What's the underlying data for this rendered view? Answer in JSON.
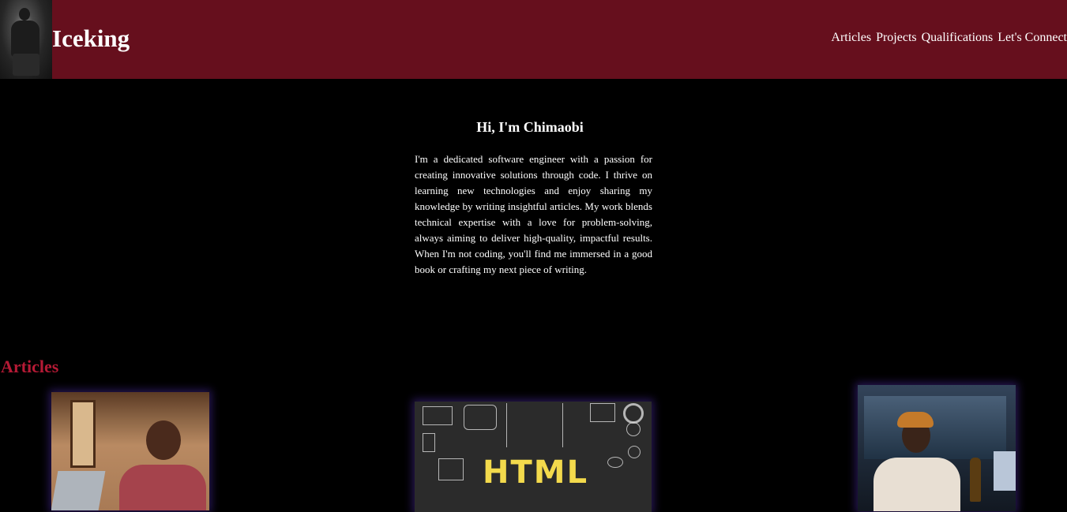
{
  "header": {
    "brand": "Iceking",
    "nav": [
      "Articles",
      "Projects",
      "Qualifications",
      "Let's Connect"
    ],
    "colors": {
      "background": "#660f1d"
    }
  },
  "hero": {
    "title": "Hi, I'm Chimaobi",
    "text": "I'm a dedicated software engineer with a passion for creating innovative solutions through code. I thrive on learning new technologies and enjoy sharing my knowledge by writing insightful articles. My work blends technical expertise with a love for problem-solving, always aiming to deliver high-quality, impactful results. When I'm not coding, you'll find me immersed in a good book or crafting my next piece of writing."
  },
  "articles": {
    "title": "Articles",
    "title_color": "#b51a35",
    "cards": [
      {
        "image": "child-with-laptop-image"
      },
      {
        "image": "html-chalkboard-image",
        "word": "HTML"
      },
      {
        "image": "man-with-bottle-image"
      }
    ]
  }
}
